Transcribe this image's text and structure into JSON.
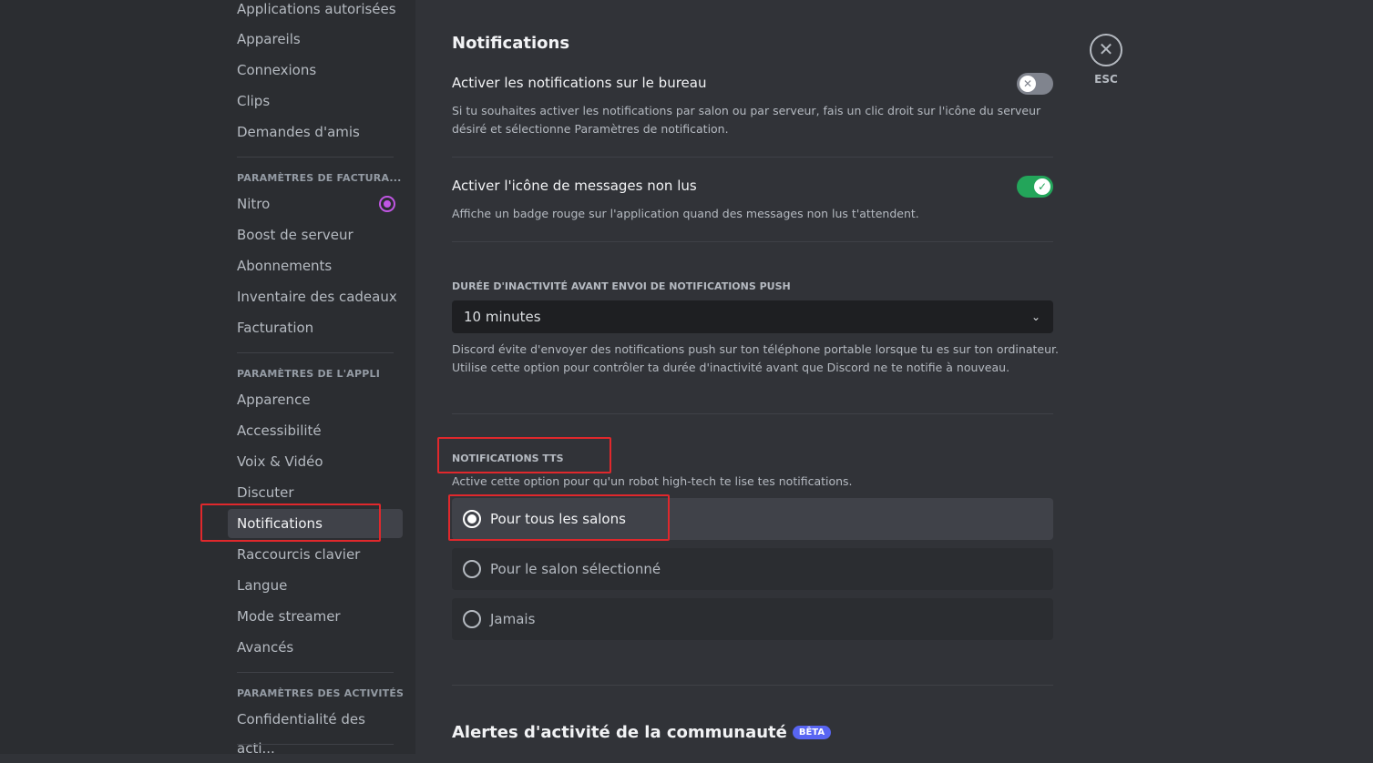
{
  "sidebar": {
    "items_top": [
      "Applications autorisées",
      "Appareils",
      "Connexions",
      "Clips",
      "Demandes d'amis"
    ],
    "billing_header": "PARAMÈTRES DE FACTURA...",
    "billing": [
      "Nitro",
      "Boost de serveur",
      "Abonnements",
      "Inventaire des cadeaux",
      "Facturation"
    ],
    "app_header": "PARAMÈTRES DE L'APPLI",
    "app": [
      "Apparence",
      "Accessibilité",
      "Voix & Vidéo",
      "Discuter",
      "Notifications",
      "Raccourcis clavier",
      "Langue",
      "Mode streamer",
      "Avancés"
    ],
    "activity_header": "PARAMÈTRES DES ACTIVITÉS",
    "activity": [
      "Confidentialité des acti..."
    ],
    "selected": "Notifications"
  },
  "main": {
    "title": "Notifications",
    "desktop": {
      "label": "Activer les notifications sur le bureau",
      "desc": "Si tu souhaites activer les notifications par salon ou par serveur, fais un clic droit sur l'icône du serveur désiré et sélectionne Paramètres de notification.",
      "enabled": false
    },
    "unread": {
      "label": "Activer l'icône de messages non lus",
      "desc": "Affiche un badge rouge sur l'application quand des messages non lus t'attendent.",
      "enabled": true
    },
    "idle": {
      "header": "DURÉE D'INACTIVITÉ AVANT ENVOI DE NOTIFICATIONS PUSH",
      "value": "10 minutes",
      "desc1": "Discord évite d'envoyer des notifications push sur ton téléphone portable lorsque tu es sur ton ordinateur.",
      "desc2": "Utilise cette option pour contrôler ta durée d'inactivité avant que Discord ne te notifie à nouveau."
    },
    "tts": {
      "header": "NOTIFICATIONS TTS",
      "desc": "Active cette option pour qu'un robot high-tech te lise tes notifications.",
      "options": [
        "Pour tous les salons",
        "Pour le salon sélectionné",
        "Jamais"
      ],
      "selected": "Pour tous les salons"
    },
    "community": {
      "title": "Alertes d'activité de la communauté",
      "badge": "BÊTA"
    }
  },
  "close": {
    "label": "ESC"
  },
  "colors": {
    "toggle_on": "#23a55a",
    "toggle_off": "#80848e",
    "highlight": "#e0282c",
    "beta": "#5865f2"
  }
}
